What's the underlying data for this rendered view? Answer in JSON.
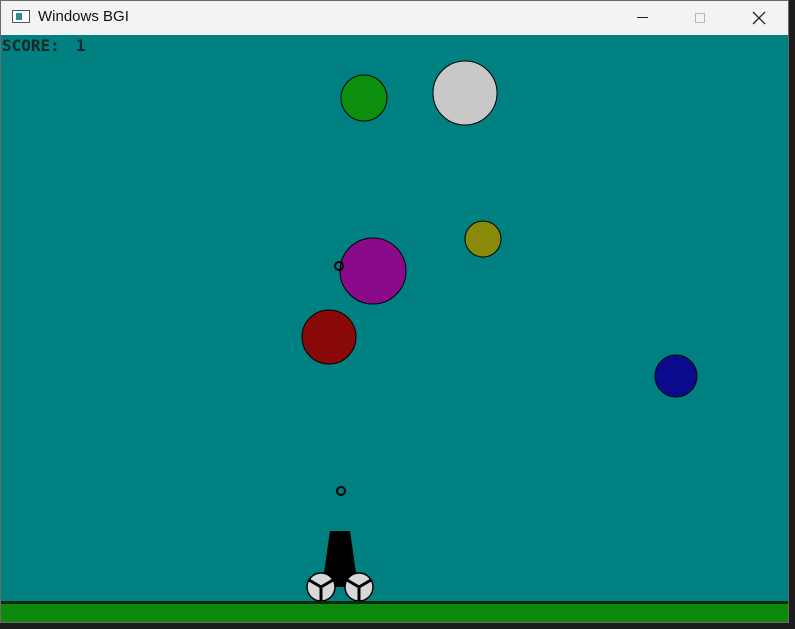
{
  "window": {
    "title": "Windows BGI"
  },
  "controls": {
    "minimize_icon": "minimize-icon",
    "maximize_icon": "maximize-icon",
    "close_icon": "close-icon"
  },
  "hud": {
    "score_label": "SCORE:",
    "score_value": "1"
  },
  "colors": {
    "sky": "#008080",
    "ground": "#0d8a0d",
    "ground_line": "#0a2a0a",
    "cannon": "#000000",
    "wheel": "#d8d8d8"
  },
  "balloons": [
    {
      "color": "#0c8f0c",
      "name": "green"
    },
    {
      "color": "#c8c8c8",
      "name": "light-gray"
    },
    {
      "color": "#8a8a0a",
      "name": "olive"
    },
    {
      "color": "#8a0a8a",
      "name": "magenta"
    },
    {
      "color": "#8a0a0a",
      "name": "dark-red"
    },
    {
      "color": "#0a0a8c",
      "name": "dark-blue"
    }
  ],
  "projectiles": 2
}
